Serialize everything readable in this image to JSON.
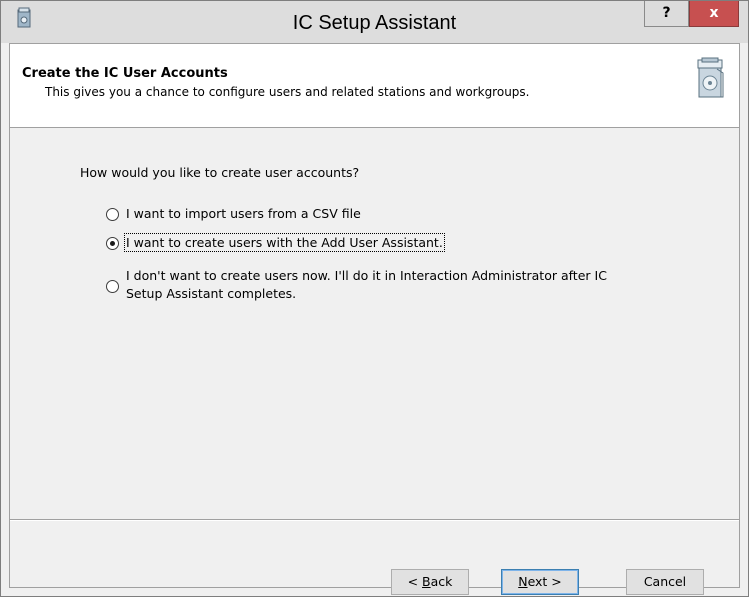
{
  "window": {
    "title": "IC Setup Assistant",
    "help_label": "?",
    "close_label": "x",
    "title_icon": "setup-app-icon"
  },
  "header": {
    "title": "Create the IC User Accounts",
    "subtitle": "This gives you a chance to configure users and related stations and workgroups.",
    "icon": "installer-box-icon"
  },
  "main": {
    "question": "How would you like to create user accounts?",
    "options": [
      {
        "label": "I want to import users from a CSV file",
        "selected": false
      },
      {
        "label": "I want to create users with the Add User Assistant.",
        "selected": true
      },
      {
        "label_line1": "I don't want to create users now.  I'll do it in Interaction Administrator after IC",
        "label_line2": "Setup Assistant completes.",
        "selected": false
      }
    ]
  },
  "footer": {
    "back_prefix": "< ",
    "back_mnemonic": "B",
    "back_rest": "ack",
    "next_mnemonic": "N",
    "next_rest": "ext >",
    "cancel_label": "Cancel"
  },
  "colors": {
    "close_button": "#c75050",
    "titlebar": "#dddddd",
    "dialog_bg": "#f0f0f0",
    "header_bg": "#ffffff"
  }
}
